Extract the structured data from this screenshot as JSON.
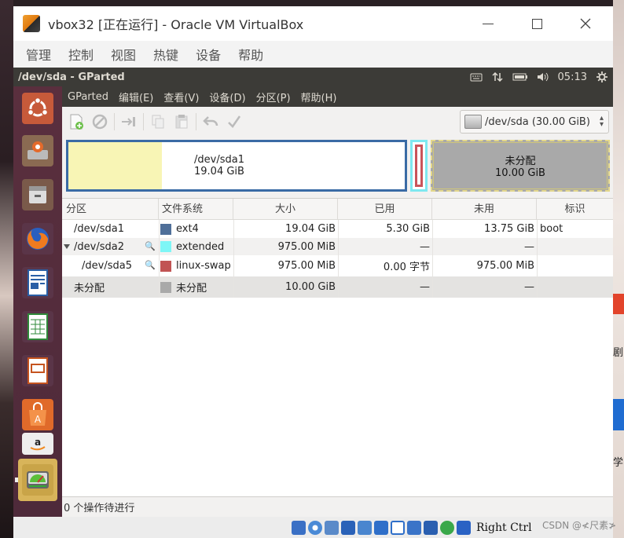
{
  "vbox": {
    "title": "vbox32 [正在运行] - Oracle VM VirtualBox",
    "menu": [
      "管理",
      "控制",
      "视图",
      "热键",
      "设备",
      "帮助"
    ],
    "right_ctrl": "Right Ctrl"
  },
  "guest_panel": {
    "title": "/dev/sda - GParted",
    "time": "05:13"
  },
  "gparted": {
    "menu": [
      "GParted",
      "编辑(E)",
      "查看(V)",
      "设备(D)",
      "分区(P)",
      "帮助(H)"
    ],
    "device": "/dev/sda  (30.00 GiB)",
    "visual": {
      "main_name": "/dev/sda1",
      "main_size": "19.04 GiB",
      "main_used_fraction": 0.278,
      "unalloc_name": "未分配",
      "unalloc_size": "10.00 GiB"
    },
    "columns": [
      "分区",
      "文件系统",
      "大小",
      "已用",
      "未用",
      "标识"
    ],
    "rows": [
      {
        "partition": "/dev/sda1",
        "fs": "ext4",
        "fs_color": "#4f6f99",
        "size": "19.04 GiB",
        "used": "5.30 GiB",
        "unused": "13.75 GiB",
        "flags": "boot"
      },
      {
        "partition": "/dev/sda2",
        "fs": "extended",
        "fs_color": "#7ef6f6",
        "size": "975.00 MiB",
        "used": "—",
        "unused": "—",
        "flags": ""
      },
      {
        "partition": "/dev/sda5",
        "fs": "linux-swap",
        "fs_color": "#c15454",
        "size": "975.00 MiB",
        "used": "0.00 字节",
        "unused": "975.00 MiB",
        "flags": ""
      },
      {
        "partition": "未分配",
        "fs": "未分配",
        "fs_color": "#a9a9a9",
        "size": "10.00 GiB",
        "used": "—",
        "unused": "—",
        "flags": ""
      }
    ],
    "status": "0 个操作待进行"
  },
  "desktop": {
    "side_text_1": "剧",
    "side_text_2": "学"
  },
  "watermark": "CSDN @≮尺素≯"
}
